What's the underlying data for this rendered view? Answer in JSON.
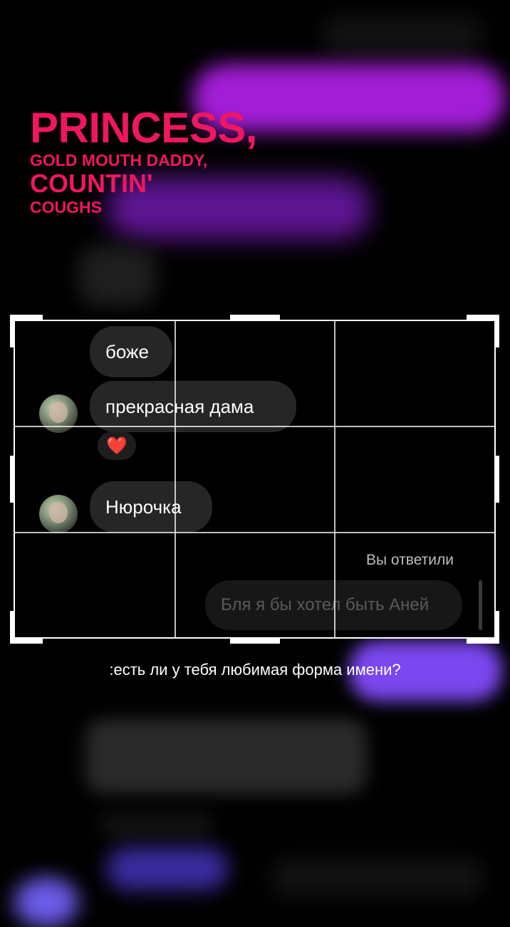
{
  "lyrics": {
    "line1": "PRINCESS,",
    "line2": "GOLD MOUTH DADDY,",
    "line3": "COUNTIN'",
    "line4": "COUGHS"
  },
  "chat": {
    "messages": [
      {
        "text": "боже"
      },
      {
        "text": "прекрасная дама",
        "reaction": "❤️"
      },
      {
        "text": "Нюрочка"
      }
    ],
    "replied_label": "Вы ответили",
    "replied_message": "Бля я бы хотел быть Аней"
  },
  "subtitle": ":есть ли у тебя любимая форма имени?",
  "colors": {
    "accent_pink": "#f0165f",
    "blur_purple": "#a21dd6",
    "blur_violet": "#7b47f0"
  }
}
